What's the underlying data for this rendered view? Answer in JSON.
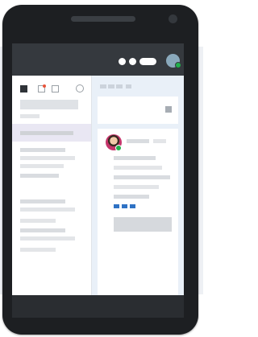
{
  "app": {
    "title": "",
    "theme_colors": {
      "topbar": "#35393e",
      "accent": "#2f72c4",
      "presence": "#21b14c",
      "badge": "#e8543a",
      "selected_row": "#e9e7f3",
      "main_bg": "#e9f0f8"
    }
  },
  "topbar": {
    "icons": [
      "more-dot-icon",
      "more-dot-icon",
      "pill-toggle-icon",
      "user-avatar-icon"
    ]
  },
  "sidebar": {
    "toolbar_icons": [
      "stop-square-icon",
      "new-doc-icon",
      "checkbox-icon",
      "circle-icon"
    ],
    "selected_index": 2
  },
  "main": {
    "card": {
      "avatar": "user-avatar-icon",
      "tags": [
        "tag-icon",
        "tag-icon",
        "tag-icon"
      ]
    }
  }
}
